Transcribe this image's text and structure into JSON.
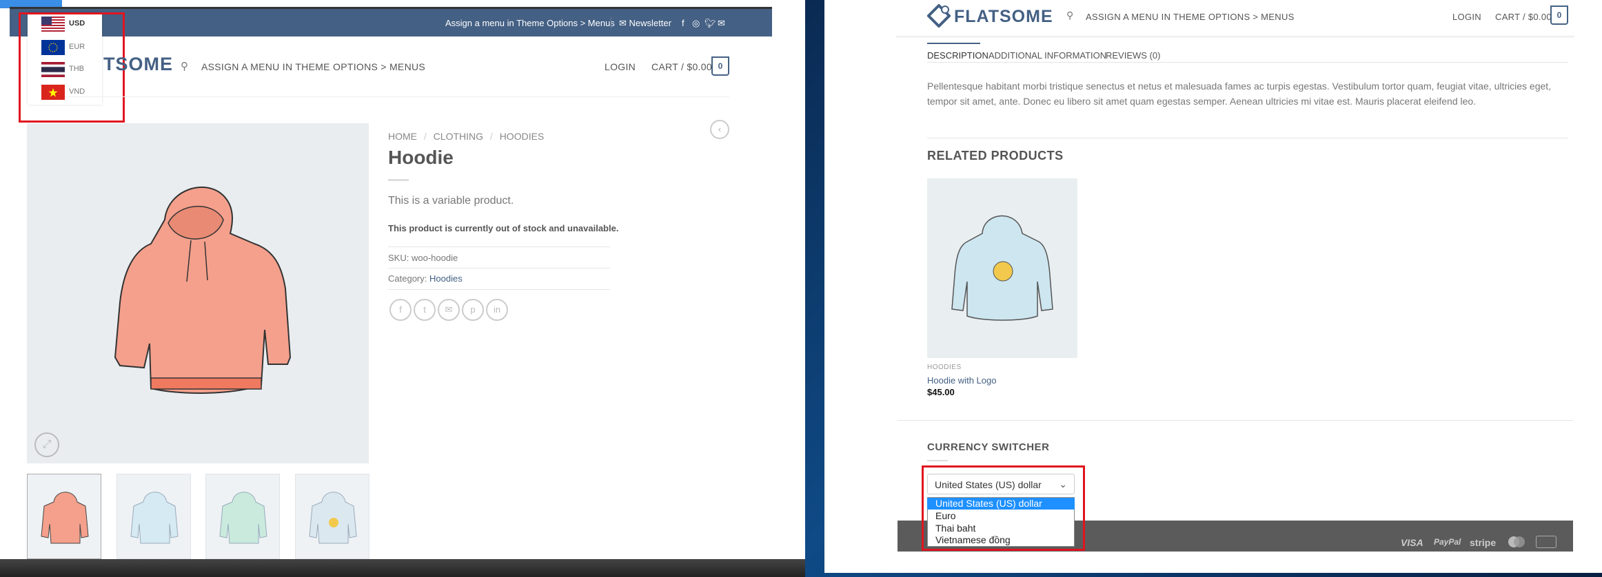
{
  "left": {
    "topbar": {
      "assign_menu": "Assign a menu in Theme Options > Menus",
      "newsletter": "Newsletter"
    },
    "currencies": [
      {
        "code": "USD"
      },
      {
        "code": "EUR"
      },
      {
        "code": "THB"
      },
      {
        "code": "VND"
      }
    ],
    "logo": "FLATSOME",
    "logo_visible": "TSOME",
    "nav": {
      "assign": "ASSIGN A MENU IN THEME OPTIONS > MENUS",
      "login": "LOGIN",
      "cart": "CART / $0.00",
      "cart_count": "0"
    },
    "breadcrumb": [
      "HOME",
      "CLOTHING",
      "HOODIES"
    ],
    "product": {
      "title": "Hoodie",
      "description": "This is a variable product.",
      "stock": "This product is currently out of stock and unavailable.",
      "sku_label": "SKU:",
      "sku": "woo-hoodie",
      "category_label": "Category:",
      "category": "Hoodies"
    }
  },
  "right": {
    "logo": "FLATSOME",
    "nav": {
      "assign": "ASSIGN A MENU IN THEME OPTIONS > MENUS",
      "login": "LOGIN",
      "cart": "CART / $0.00",
      "cart_count": "0"
    },
    "tabs": [
      "DESCRIPTION",
      "ADDITIONAL INFORMATION",
      "REVIEWS (0)"
    ],
    "description": "Pellentesque habitant morbi tristique senectus et netus et malesuada fames ac turpis egestas. Vestibulum tortor quam, feugiat vitae, ultricies eget, tempor sit amet, ante. Donec eu libero sit amet quam egestas semper. Aenean ultricies mi vitae est. Mauris placerat eleifend leo.",
    "related_title": "RELATED PRODUCTS",
    "related": {
      "category": "HOODIES",
      "name": "Hoodie with Logo",
      "price": "$45.00"
    },
    "switcher_title": "CURRENCY SWITCHER",
    "select_value": "United States (US) dollar",
    "options": [
      "United States (US) dollar",
      "Euro",
      "Thai baht",
      "Vietnamese đồng"
    ],
    "payments": [
      "VISA",
      "PayPal",
      "stripe"
    ]
  },
  "colors": {
    "brand": "#446084",
    "highlight": "#e0151f",
    "option_selected": "#1e90ff"
  }
}
